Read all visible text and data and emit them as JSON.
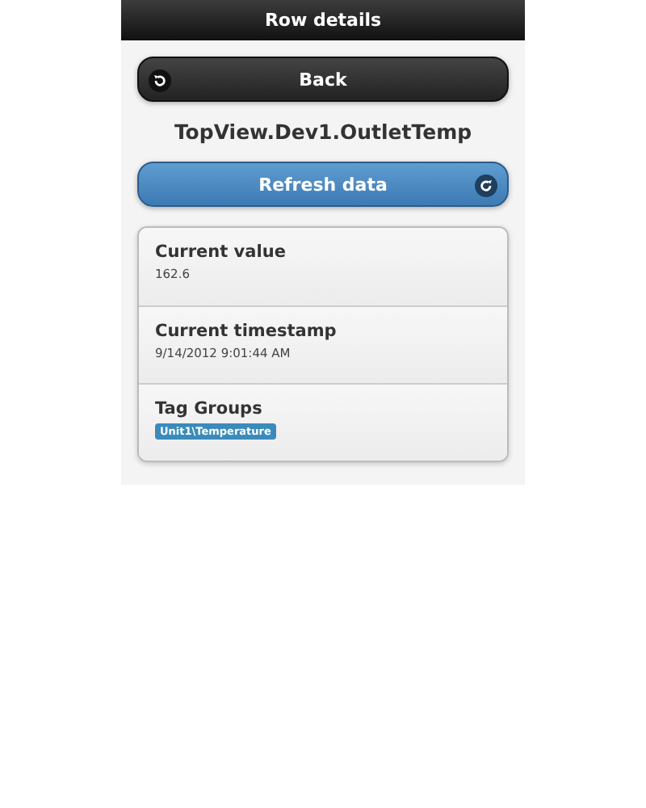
{
  "header": {
    "title": "Row details"
  },
  "back_button": {
    "label": "Back"
  },
  "tag_name": "TopView.Dev1.OutletTemp",
  "refresh_button": {
    "label": "Refresh data"
  },
  "details": [
    {
      "kind": "text",
      "label": "Current value",
      "value": "162.6"
    },
    {
      "kind": "text",
      "label": "Current timestamp",
      "value": "9/14/2012 9:01:44 AM"
    },
    {
      "kind": "tags",
      "label": "Tag Groups",
      "tags": [
        "Unit1\\Temperature"
      ]
    }
  ]
}
